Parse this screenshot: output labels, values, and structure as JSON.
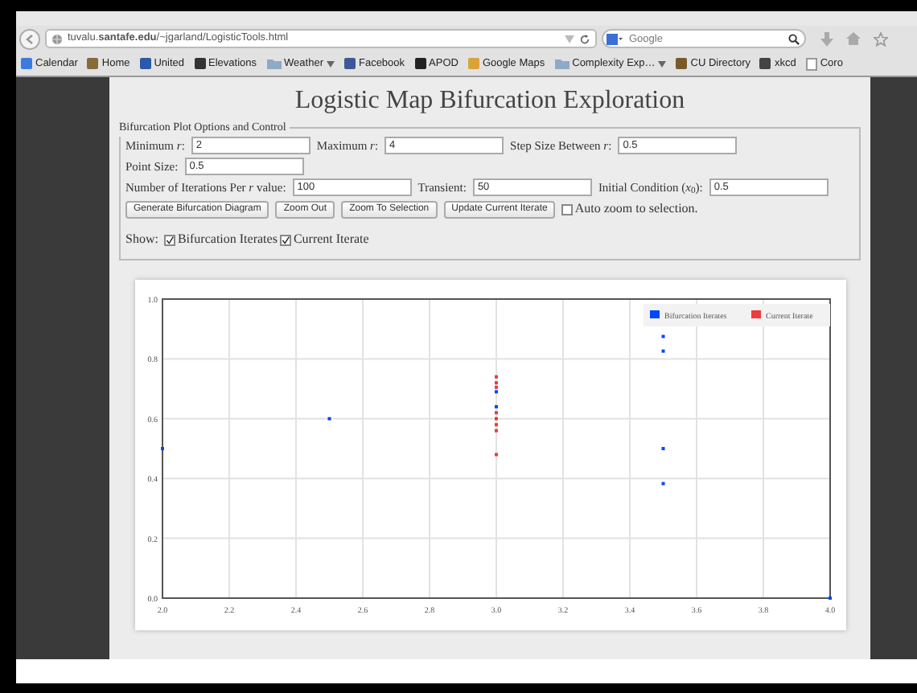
{
  "browser": {
    "url": "tuvalu.**santafe.edu**/~jgarland/LogisticTools.html",
    "search_placeholder": "Google",
    "bookmarks": [
      {
        "label": "Calendar",
        "kind": "site",
        "dropdown": false
      },
      {
        "label": "Home",
        "kind": "site",
        "dropdown": false
      },
      {
        "label": "United",
        "kind": "site",
        "dropdown": false
      },
      {
        "label": "Elevations",
        "kind": "site",
        "dropdown": false
      },
      {
        "label": "Weather",
        "kind": "folder",
        "dropdown": true
      },
      {
        "label": "Facebook",
        "kind": "site",
        "dropdown": false
      },
      {
        "label": "APOD",
        "kind": "site",
        "dropdown": false
      },
      {
        "label": "Google Maps",
        "kind": "site",
        "dropdown": false
      },
      {
        "label": "Complexity Exp…",
        "kind": "folder",
        "dropdown": true
      },
      {
        "label": "CU Directory",
        "kind": "site",
        "dropdown": false
      },
      {
        "label": "xkcd",
        "kind": "site",
        "dropdown": false
      },
      {
        "label": "Coro",
        "kind": "blank",
        "dropdown": false
      }
    ]
  },
  "page": {
    "title": "Logistic Map Bifurcation Exploration",
    "options": {
      "legend": "Bifurcation Plot Options and Control",
      "fields_row_1": [
        {
          "label": "Minimum *r*:",
          "value": "2"
        },
        {
          "label": "Maximum *r*:",
          "value": "4"
        },
        {
          "label": "Step Size Between *r*:",
          "value": "0.5"
        },
        {
          "label": "Point Size:",
          "value": "0.5"
        }
      ],
      "fields_row_2": [
        {
          "label": "Number of Iterations Per *r* value:",
          "value": "100"
        },
        {
          "label": "Transient:",
          "value": "50"
        },
        {
          "label": "Initial Condition (*x*$_{0}$):",
          "value": "0.5"
        }
      ],
      "buttons": [
        "Generate Bifurcation Diagram",
        "Zoom Out",
        "Zoom To Selection",
        "Update Current Iterate"
      ],
      "auto_zoom": {
        "label": "Auto zoom to selection.",
        "checked": false
      },
      "show": {
        "label": "Show:",
        "options": [
          {
            "label": "Bifurcation Iterates",
            "checked": true
          },
          {
            "label": "Current Iterate",
            "checked": true
          }
        ]
      }
    },
    "chart_data": {
      "type": "scatter",
      "grid": true,
      "legend": true,
      "xlim": [
        2,
        4
      ],
      "ylim": [
        0,
        1
      ],
      "xticks": [
        {
          "value": 2,
          "label": "2.0"
        },
        {
          "value": 2.2,
          "label": "2.2"
        },
        {
          "value": 2.4,
          "label": "2.4"
        },
        {
          "value": 2.6,
          "label": "2.6"
        },
        {
          "value": 2.8,
          "label": "2.8"
        },
        {
          "value": 3,
          "label": "3.0"
        },
        {
          "value": 3.2,
          "label": "3.2"
        },
        {
          "value": 3.4,
          "label": "3.4"
        },
        {
          "value": 3.6,
          "label": "3.6"
        },
        {
          "value": 3.8,
          "label": "3.8"
        },
        {
          "value": 4,
          "label": "4.0"
        }
      ],
      "yticks": [
        {
          "value": 0,
          "label": "0.0"
        },
        {
          "value": 0.2,
          "label": "0.2"
        },
        {
          "value": 0.4,
          "label": "0.4"
        },
        {
          "value": 0.6,
          "label": "0.6"
        },
        {
          "value": 0.8,
          "label": "0.8"
        },
        {
          "value": 1,
          "label": "1.0"
        }
      ],
      "series": [
        {
          "name": "Bifurcation Iterates",
          "color": "#0047ff",
          "x": [
            2,
            2.5,
            3,
            3,
            3.5,
            3.5,
            3.5,
            3.5,
            4
          ],
          "values": [
            0.5,
            0.6,
            0.64,
            0.69,
            0.875,
            0.826,
            0.5,
            0.383,
            0
          ]
        },
        {
          "name": "Current Iterate",
          "color": "#ee3b3b",
          "x": [
            3,
            3,
            3,
            3,
            3,
            3,
            3,
            3
          ],
          "values": [
            0.48,
            0.56,
            0.58,
            0.6,
            0.62,
            0.705,
            0.72,
            0.74
          ]
        }
      ]
    }
  }
}
